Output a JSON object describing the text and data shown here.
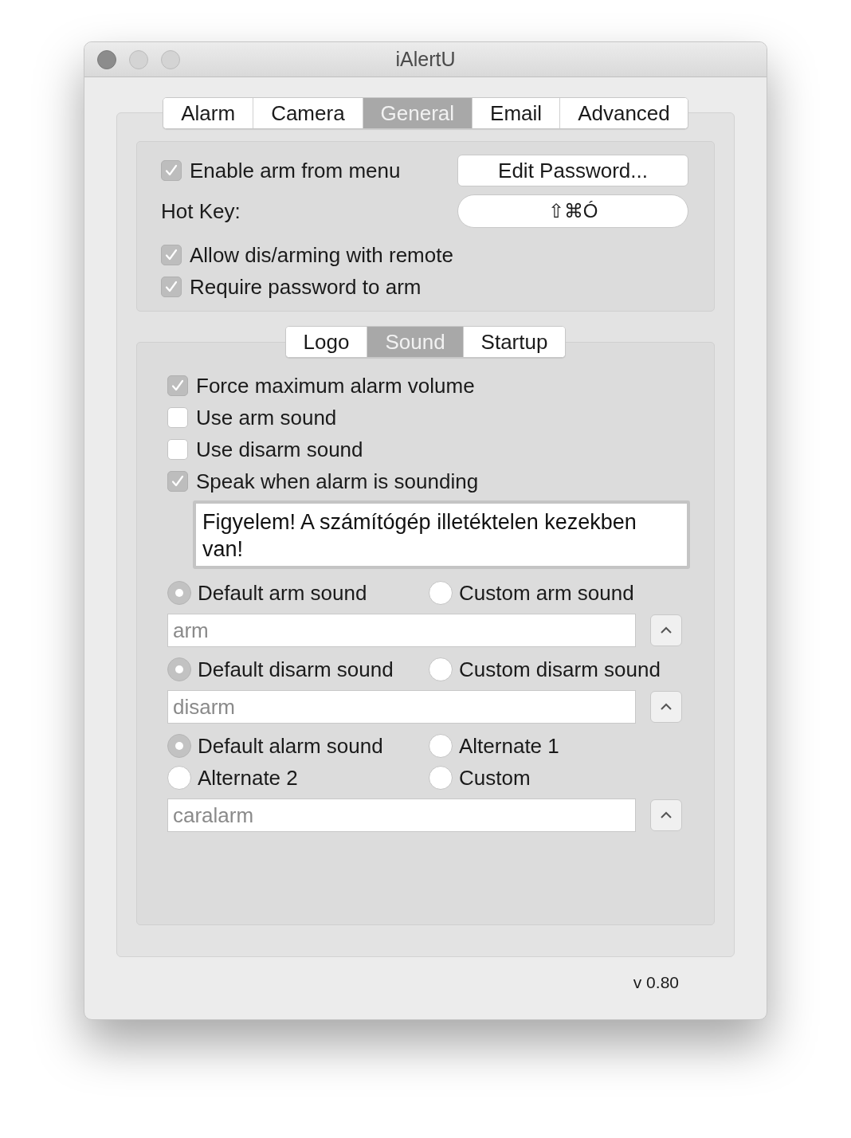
{
  "window": {
    "title": "iAlertU"
  },
  "tabs": [
    {
      "label": "Alarm",
      "selected": false
    },
    {
      "label": "Camera",
      "selected": false
    },
    {
      "label": "General",
      "selected": true
    },
    {
      "label": "Email",
      "selected": false
    },
    {
      "label": "Advanced",
      "selected": false
    }
  ],
  "general": {
    "enable_arm": {
      "label": "Enable arm from menu",
      "checked": true
    },
    "edit_password_button": "Edit Password...",
    "hot_key": {
      "label": "Hot Key:",
      "value": "⇧⌘Ó"
    },
    "options": [
      {
        "label": "Allow dis/arming with remote",
        "checked": true
      },
      {
        "label": "Require password to arm",
        "checked": true
      }
    ]
  },
  "sub_tabs": [
    {
      "label": "Logo",
      "selected": false
    },
    {
      "label": "Sound",
      "selected": true
    },
    {
      "label": "Startup",
      "selected": false
    }
  ],
  "sound": {
    "options": [
      {
        "label": "Force maximum alarm volume",
        "checked": true
      },
      {
        "label": "Use arm sound",
        "checked": false
      },
      {
        "label": "Use disarm sound",
        "checked": false
      },
      {
        "label": "Speak when alarm is sounding",
        "checked": true
      }
    ],
    "speech_text": "Figyelem! A számítógép illetéktelen kezekben van!",
    "groups": [
      {
        "radios": [
          {
            "label": "Default arm sound",
            "selected": true
          },
          {
            "label": "Custom arm sound",
            "selected": false
          }
        ],
        "field": {
          "value": "arm"
        }
      },
      {
        "radios": [
          {
            "label": "Default disarm sound",
            "selected": true
          },
          {
            "label": "Custom disarm sound",
            "selected": false
          }
        ],
        "field": {
          "value": "disarm"
        }
      },
      {
        "radios": [
          {
            "label": "Default alarm sound",
            "selected": true
          },
          {
            "label": "Alternate 1",
            "selected": false
          },
          {
            "label": "Alternate 2",
            "selected": false
          },
          {
            "label": "Custom",
            "selected": false
          }
        ],
        "field": {
          "value": "caralarm"
        }
      }
    ]
  },
  "version": "v 0.80"
}
